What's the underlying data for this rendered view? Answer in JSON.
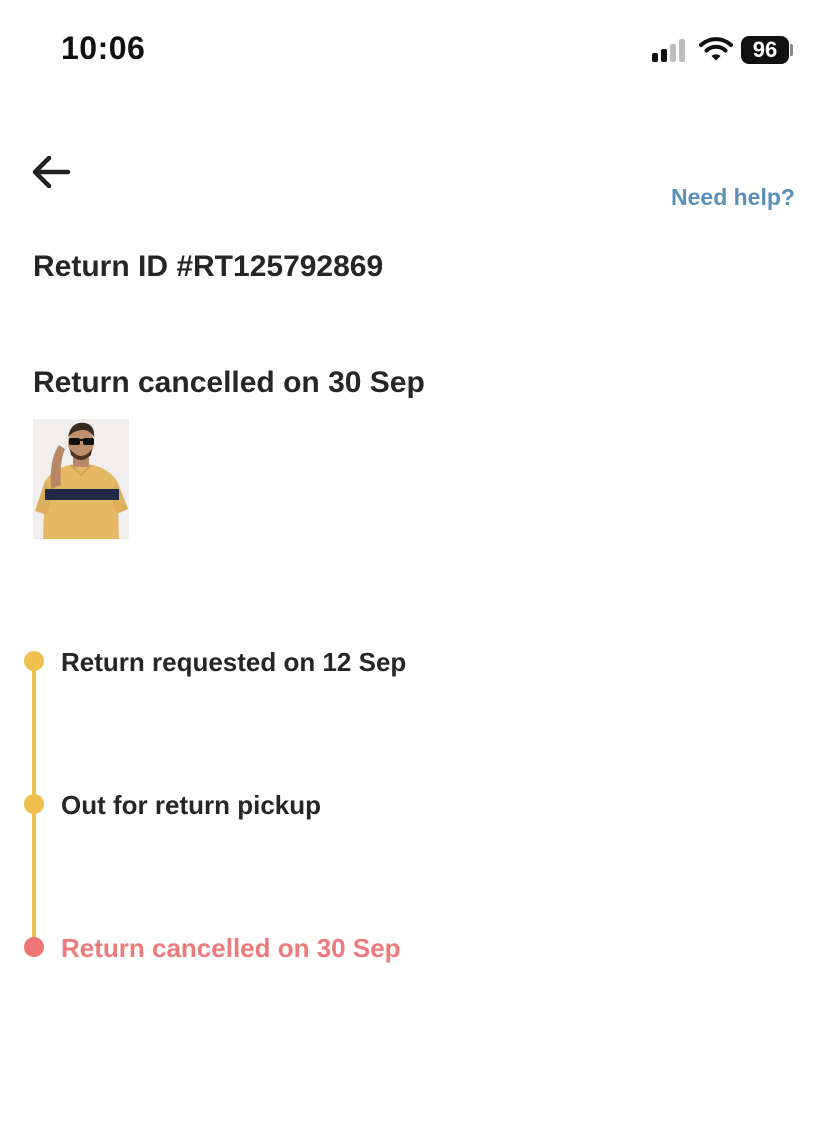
{
  "status_bar": {
    "time": "10:06",
    "battery": "96",
    "signal_icon": "cellular-signal-icon",
    "wifi_icon": "wifi-icon"
  },
  "header": {
    "back_icon": "back-arrow-icon",
    "help_label": "Need help?"
  },
  "return": {
    "id_label": "Return ID #RT125792869",
    "status_title": "Return cancelled on 30 Sep"
  },
  "timeline": [
    {
      "label": "Return requested on 12 Sep",
      "state": "done"
    },
    {
      "label": "Out for return pickup",
      "state": "done"
    },
    {
      "label": "Return cancelled on 30 Sep",
      "state": "cancelled"
    }
  ],
  "colors": {
    "accent_link": "#5a90b5",
    "timeline_done": "#edc04f",
    "timeline_cancelled": "#ee7677"
  }
}
